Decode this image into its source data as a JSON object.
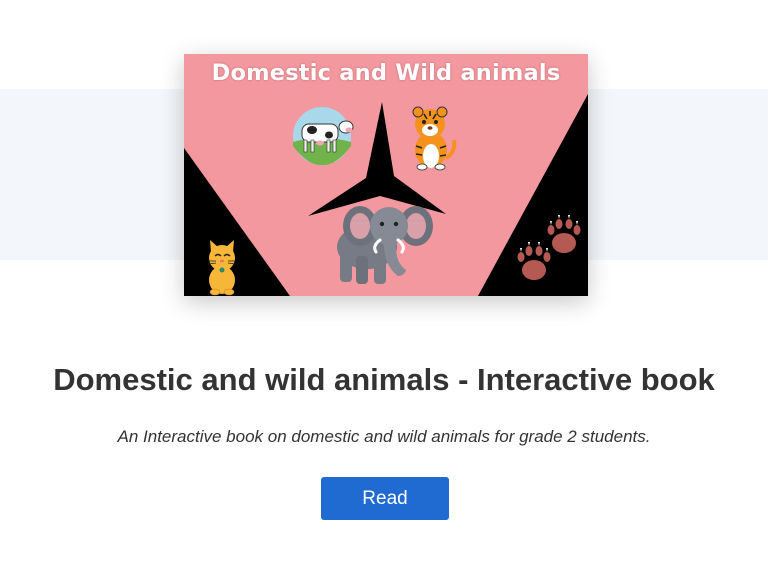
{
  "cover": {
    "title": "Domestic and Wild animals",
    "colors": {
      "background": "#f4989f",
      "shapes": "#000000",
      "cover_title": "#ffffff"
    },
    "icons": [
      "cow-icon",
      "tiger-icon",
      "elephant-icon",
      "cat-icon",
      "paw-prints-icon"
    ]
  },
  "book": {
    "title": "Domestic and wild animals - Interactive book",
    "description": "An Interactive book on domestic and wild animals for grade 2 students."
  },
  "actions": {
    "read_label": "Read"
  },
  "colors": {
    "accent": "#1f6bd1",
    "band": "#f3f6fa",
    "text": "#333333"
  }
}
